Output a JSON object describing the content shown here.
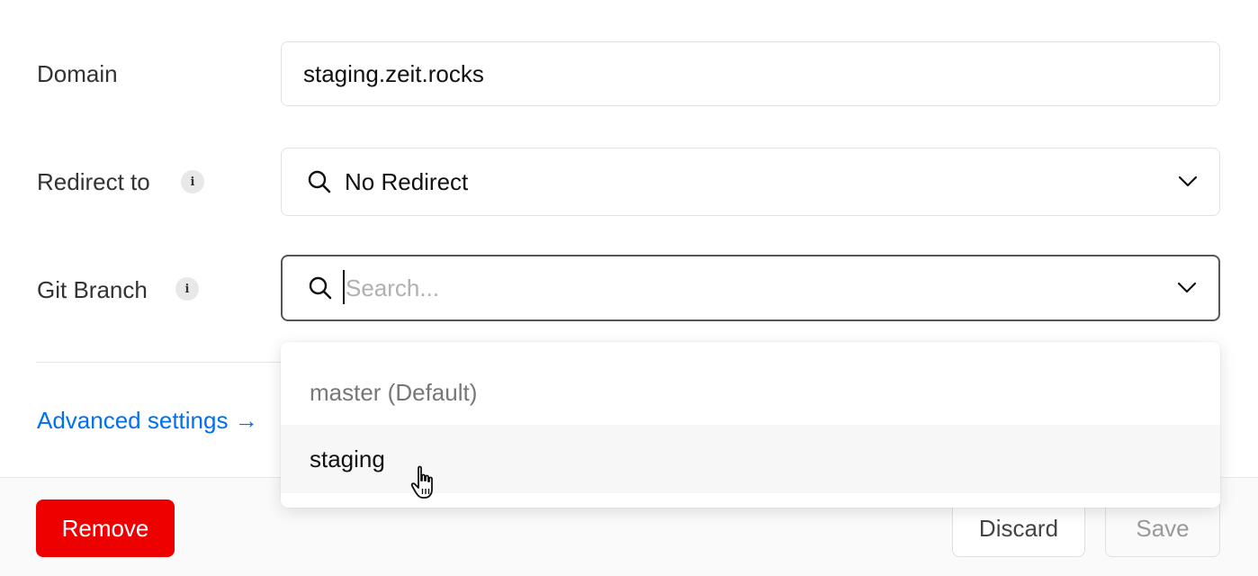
{
  "form": {
    "domain": {
      "label": "Domain",
      "value": "staging.zeit.rocks"
    },
    "redirect": {
      "label": "Redirect to",
      "info_icon": "i",
      "value": "No Redirect"
    },
    "git_branch": {
      "label": "Git Branch",
      "info_icon": "i",
      "placeholder": "Search..."
    },
    "advanced_link": "Advanced settings →"
  },
  "dropdown": {
    "options": [
      {
        "label": "master (Default)"
      },
      {
        "label": "staging"
      }
    ]
  },
  "footer": {
    "remove_label": "Remove",
    "discard_label": "Discard",
    "save_label": "Save"
  },
  "colors": {
    "accent": "#0070f3",
    "danger": "#ee0000"
  },
  "icons": [
    "search-icon",
    "chevron-down-icon",
    "info-icon",
    "hand-pointer-cursor-icon"
  ]
}
